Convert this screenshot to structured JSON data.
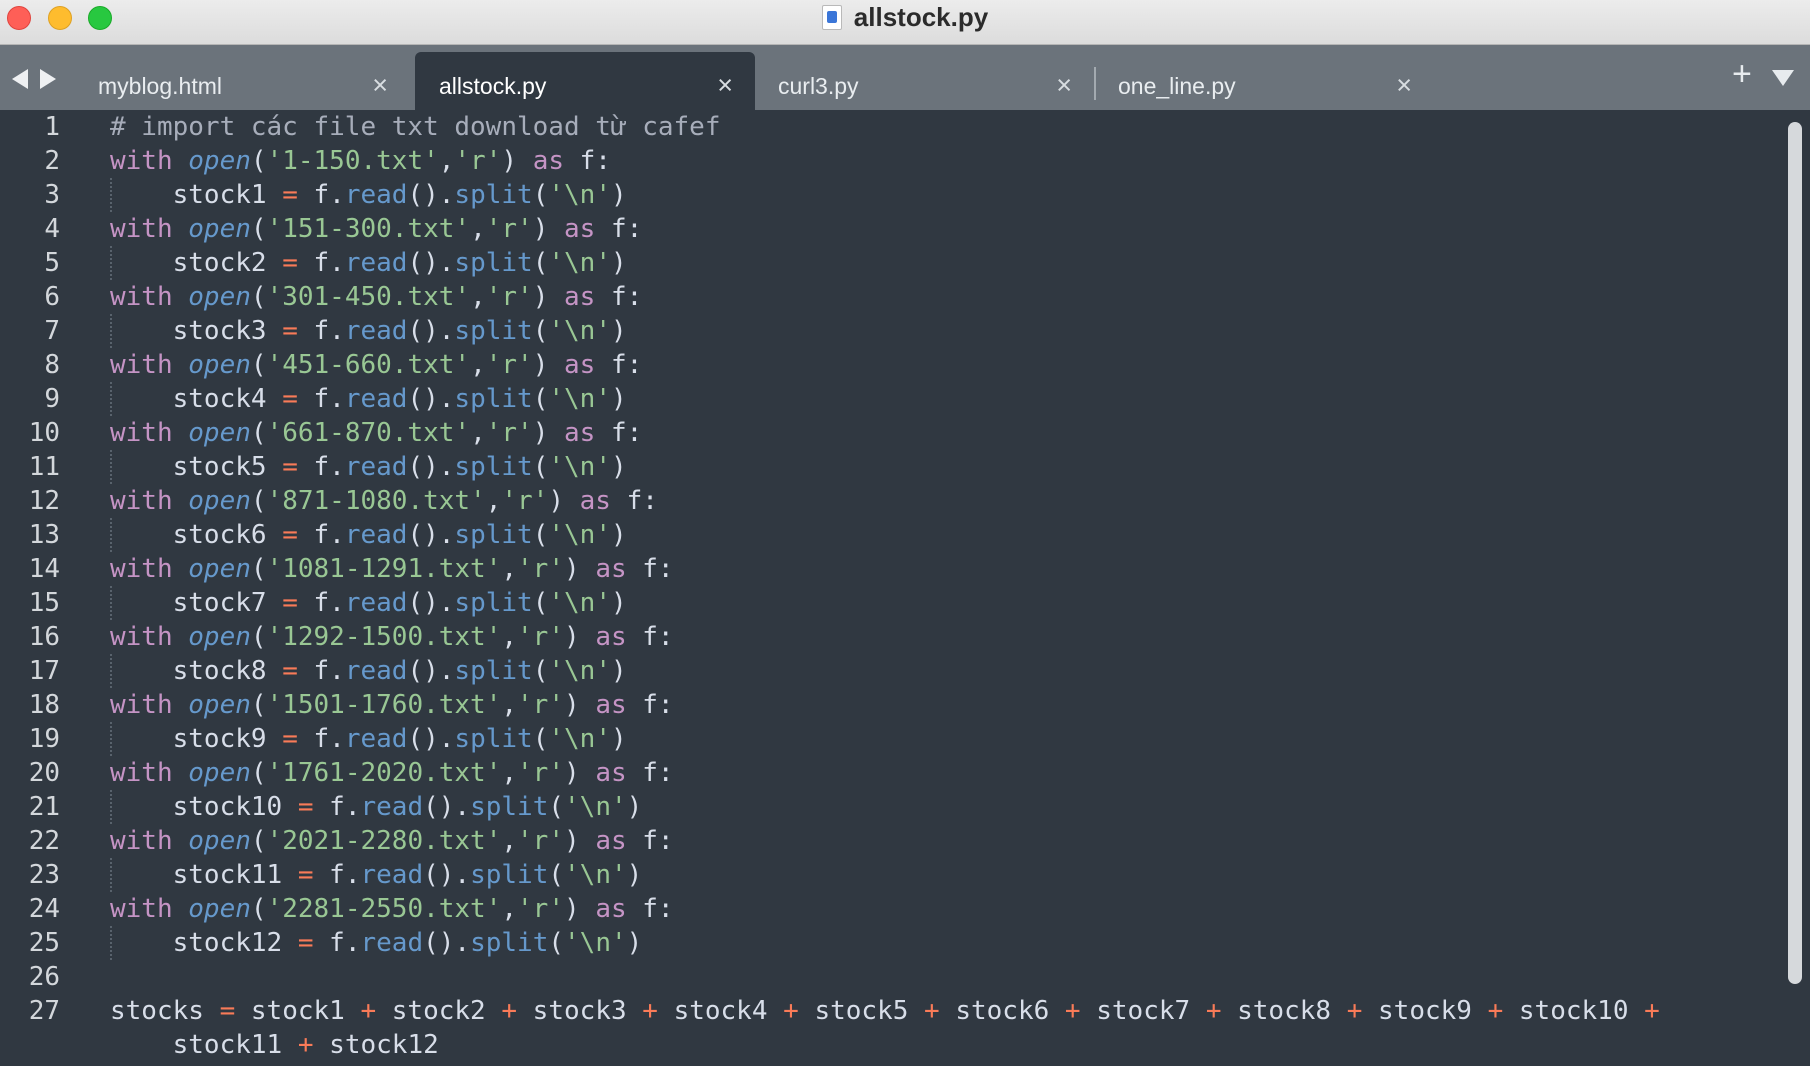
{
  "window": {
    "title": "allstock.py"
  },
  "tabs": [
    {
      "label": "myblog.html",
      "close": "×"
    },
    {
      "label": "allstock.py",
      "close": "×"
    },
    {
      "label": "curl3.py",
      "close": "×"
    },
    {
      "label": "one_line.py",
      "close": "×"
    }
  ],
  "tabbar": {
    "plus": "+"
  },
  "editor": {
    "line_numbers": [
      "1",
      "2",
      "3",
      "4",
      "5",
      "6",
      "7",
      "8",
      "9",
      "10",
      "11",
      "12",
      "13",
      "14",
      "15",
      "16",
      "17",
      "18",
      "19",
      "20",
      "21",
      "22",
      "23",
      "24",
      "25",
      "26",
      "27"
    ],
    "comment": "# import các file txt download từ cafef",
    "opens": [
      {
        "file": "'1-150.txt'",
        "var": "stock1"
      },
      {
        "file": "'151-300.txt'",
        "var": "stock2"
      },
      {
        "file": "'301-450.txt'",
        "var": "stock3"
      },
      {
        "file": "'451-660.txt'",
        "var": "stock4"
      },
      {
        "file": "'661-870.txt'",
        "var": "stock5"
      },
      {
        "file": "'871-1080.txt'",
        "var": "stock6"
      },
      {
        "file": "'1081-1291.txt'",
        "var": "stock7"
      },
      {
        "file": "'1292-1500.txt'",
        "var": "stock8"
      },
      {
        "file": "'1501-1760.txt'",
        "var": "stock9"
      },
      {
        "file": "'1761-2020.txt'",
        "var": "stock10"
      },
      {
        "file": "'2021-2280.txt'",
        "var": "stock11"
      },
      {
        "file": "'2281-2550.txt'",
        "var": "stock12"
      }
    ],
    "tokens": {
      "with": "with",
      "open": "open",
      "lparen": "(",
      "comma": ",",
      "mode": "'r'",
      "rparen_as": ") ",
      "as": "as",
      "f_colon": " f:",
      "indent": "    ",
      "eq": "=",
      "f_dot": "f.",
      "read": "read",
      "parens_dot": "().",
      "split": "split",
      "newline_str": "'\\n'",
      "rparen": ")",
      "plus": "+"
    },
    "sum_line": {
      "lhs": "stocks",
      "terms_line1": [
        "stock1",
        "stock2",
        "stock3",
        "stock4",
        "stock5",
        "stock6",
        "stock7",
        "stock8",
        "stock9",
        "stock10"
      ],
      "terms_line2": [
        "stock11",
        "stock12"
      ]
    }
  }
}
